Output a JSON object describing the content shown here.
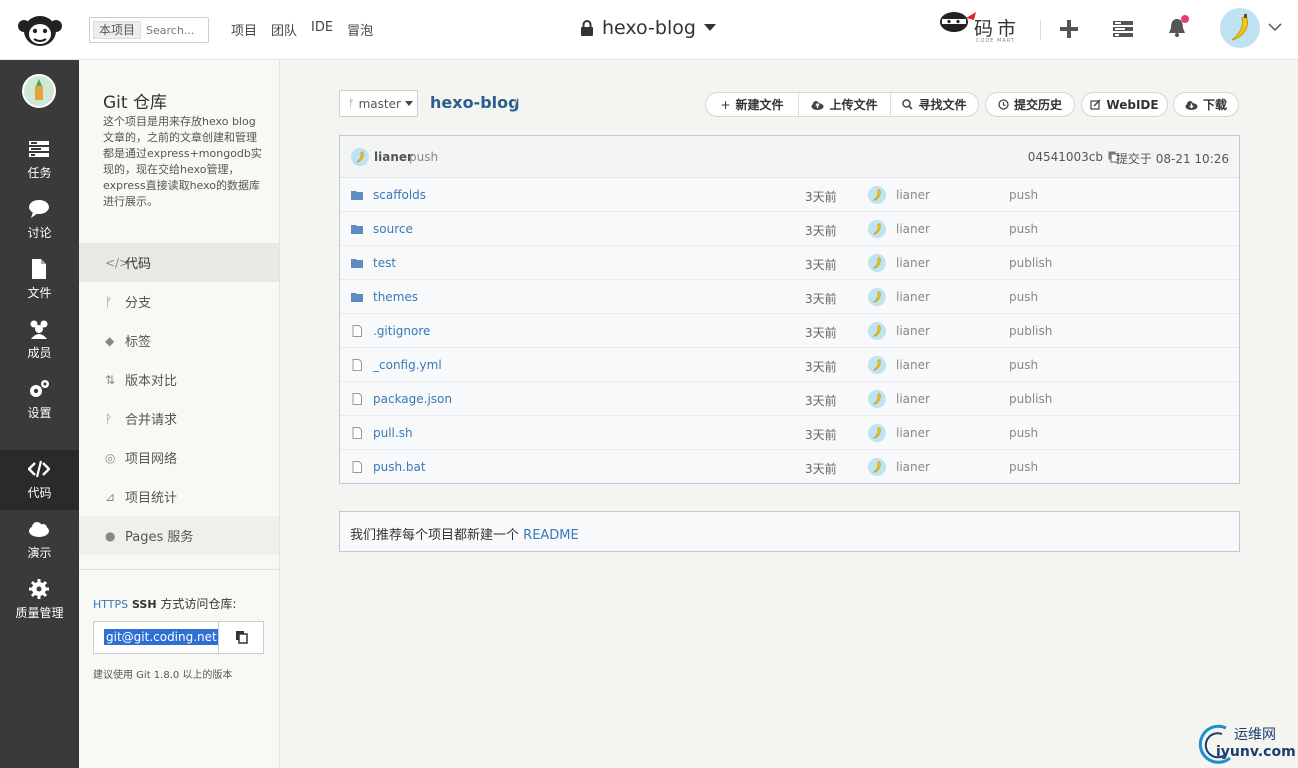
{
  "header": {
    "scope_tag": "本项目",
    "search_placeholder": "Search...",
    "nav": [
      "项目",
      "团队",
      "IDE",
      "冒泡"
    ],
    "project_name": "hexo-blog",
    "brand_text": "码市",
    "brand_sub": "CODE MART"
  },
  "sidebar": {
    "items": [
      {
        "label": "任务",
        "icon": "tasks-icon"
      },
      {
        "label": "讨论",
        "icon": "discussion-icon"
      },
      {
        "label": "文件",
        "icon": "file-icon"
      },
      {
        "label": "成员",
        "icon": "members-icon"
      },
      {
        "label": "设置",
        "icon": "settings-icon"
      },
      {
        "label": "代码",
        "icon": "code-icon",
        "active": true
      },
      {
        "label": "演示",
        "icon": "cloud-icon"
      },
      {
        "label": "质量管理",
        "icon": "quality-icon"
      }
    ]
  },
  "panel": {
    "title": "Git 仓库",
    "description": "这个项目是用来存放hexo blog文章的，之前的文章创建和管理都是通过express+mongodb实现的，现在交给hexo管理，express直接读取hexo的数据库进行展示。",
    "nav": [
      {
        "label": "代码",
        "icon": "</>"
      },
      {
        "label": "分支",
        "icon": "ᚠ"
      },
      {
        "label": "标签",
        "icon": "◆"
      },
      {
        "label": "版本对比",
        "icon": "⇅"
      },
      {
        "label": "合并请求",
        "icon": "ᚹ"
      },
      {
        "label": "项目网络",
        "icon": "◎"
      },
      {
        "label": "项目统计",
        "icon": "⊿"
      },
      {
        "label": "Pages 服务",
        "icon": "●"
      }
    ],
    "clone_https": "HTTPS",
    "clone_ssh": "SSH",
    "clone_label": "方式访问仓库:",
    "clone_url": "git@git.coding.net",
    "clone_hint": "建议使用 Git 1.8.0 以上的版本"
  },
  "main": {
    "branch": "master",
    "repo": "hexo-blog",
    "actions": {
      "new_file": "新建文件",
      "upload_file": "上传文件",
      "find_file": "寻找文件",
      "history": "提交历史",
      "webide": "WebIDE",
      "download": "下载"
    },
    "last_commit": {
      "user": "lianer",
      "message": "push",
      "hash": "04541003cb",
      "time": "提交于 08-21 10:26"
    },
    "files": [
      {
        "name": "scaffolds",
        "type": "dir",
        "age": "3天前",
        "user": "lianer",
        "msg": "push"
      },
      {
        "name": "source",
        "type": "dir",
        "age": "3天前",
        "user": "lianer",
        "msg": "push"
      },
      {
        "name": "test",
        "type": "dir",
        "age": "3天前",
        "user": "lianer",
        "msg": "publish"
      },
      {
        "name": "themes",
        "type": "dir",
        "age": "3天前",
        "user": "lianer",
        "msg": "push"
      },
      {
        "name": ".gitignore",
        "type": "file",
        "age": "3天前",
        "user": "lianer",
        "msg": "publish"
      },
      {
        "name": "_config.yml",
        "type": "file",
        "age": "3天前",
        "user": "lianer",
        "msg": "push"
      },
      {
        "name": "package.json",
        "type": "file",
        "age": "3天前",
        "user": "lianer",
        "msg": "publish"
      },
      {
        "name": "pull.sh",
        "type": "file",
        "age": "3天前",
        "user": "lianer",
        "msg": "push"
      },
      {
        "name": "push.bat",
        "type": "file",
        "age": "3天前",
        "user": "lianer",
        "msg": "push"
      }
    ],
    "readme_prefix": "我们推荐每个项目都新建一个",
    "readme_link": "README"
  },
  "watermark": {
    "cn": "运维网",
    "en": "iyunv.com"
  },
  "colors": {
    "sidebar_bg": "#3a3a3a",
    "link": "#3879b7",
    "repo_link": "#2b5d8d",
    "notify_dot": "#e83e6c"
  }
}
